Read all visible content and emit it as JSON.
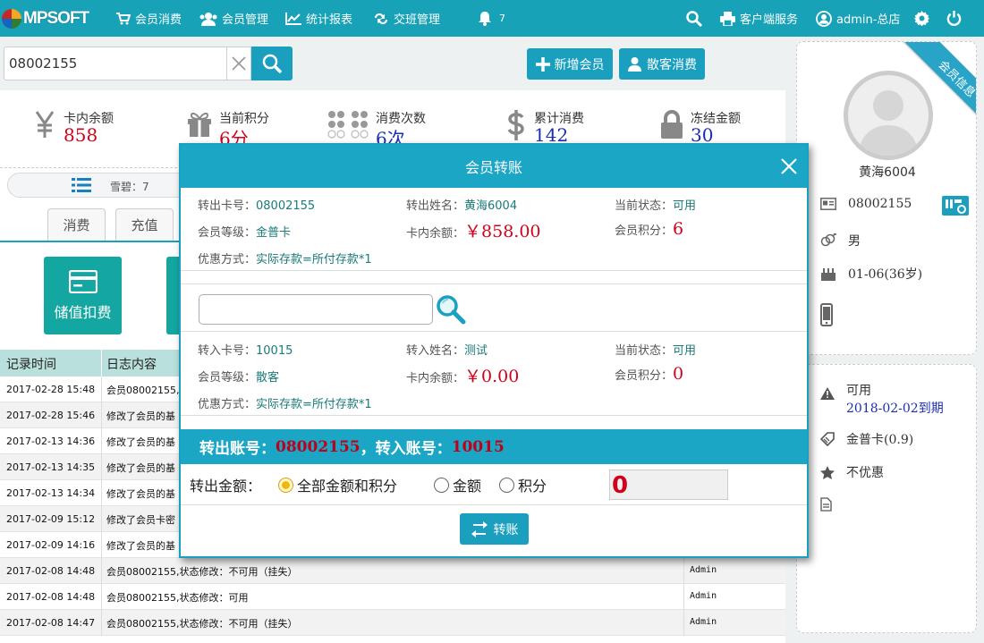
{
  "brand": {
    "logo_text": "MPSOFT"
  },
  "nav": {
    "items": [
      {
        "label": "会员消费",
        "icon": "cart-icon"
      },
      {
        "label": "会员管理",
        "icon": "users-icon"
      },
      {
        "label": "统计报表",
        "icon": "chart-icon"
      },
      {
        "label": "交班管理",
        "icon": "swap-icon"
      },
      {
        "label": "7",
        "icon": "bell-icon"
      }
    ],
    "client_service": "客户端服务",
    "user": "admin-总店"
  },
  "search": {
    "value": "08002155",
    "placeholder": ""
  },
  "actions": {
    "add_member": "新增会员",
    "walk_in": "散客消费"
  },
  "stats": [
    {
      "label": "卡内余额",
      "value": "858",
      "icon": "yen-icon"
    },
    {
      "label": "当前积分",
      "value": "6分",
      "icon": "gift-icon"
    },
    {
      "label": "消费次数",
      "value": "6次",
      "icon": "dots-grid-icon"
    },
    {
      "label": "累计消费",
      "value": "142",
      "icon": "dollar-icon"
    },
    {
      "label": "冻结金额",
      "value": "30",
      "icon": "lock-icon"
    }
  ],
  "pillbar": {
    "text": "雪碧：7"
  },
  "tabs": [
    "消费",
    "充值"
  ],
  "tiles": [
    {
      "label": "储值扣费"
    }
  ],
  "log": {
    "headers": [
      "记录时间",
      "日志内容"
    ],
    "rows": [
      {
        "time": "2017-02-28 15:48",
        "desc": "会员08002155,",
        "user": ""
      },
      {
        "time": "2017-02-28 15:46",
        "desc": "修改了会员的基",
        "user": ""
      },
      {
        "time": "2017-02-13 14:36",
        "desc": "修改了会员的基",
        "user": ""
      },
      {
        "time": "2017-02-13 14:35",
        "desc": "修改了会员的基",
        "user": ""
      },
      {
        "time": "2017-02-13 14:34",
        "desc": "修改了会员的基",
        "user": ""
      },
      {
        "time": "2017-02-09 15:12",
        "desc": "修改了会员卡密",
        "user": ""
      },
      {
        "time": "2017-02-09 14:16",
        "desc": "修改了会员的基",
        "user": ""
      },
      {
        "time": "2017-02-08 14:48",
        "desc": "会员08002155,状态修改：不可用（挂失）",
        "user": "Admin"
      },
      {
        "time": "2017-02-08 14:48",
        "desc": "会员08002155,状态修改：可用",
        "user": "Admin"
      },
      {
        "time": "2017-02-08 14:47",
        "desc": "会员08002155,状态修改：不可用（挂失）",
        "user": "Admin"
      }
    ]
  },
  "member": {
    "ribbon": "会员信息",
    "name": "黄海6004",
    "card": "08002155",
    "gender": "男",
    "birthday": "01-06(36岁)",
    "phone": "",
    "status": "可用",
    "expiry": "2018-02-02到期",
    "level": "金普卡(0.9)",
    "discount": "不优惠",
    "note": ""
  },
  "modal": {
    "title": "会员转账",
    "from": {
      "card_label": "转出卡号：",
      "card": "08002155",
      "name_label": "转出姓名：",
      "name": "黄海6004",
      "status_label": "当前状态：",
      "status": "可用",
      "level_label": "会员等级：",
      "level": "金普卡",
      "balance_label": "卡内余额：",
      "balance": "￥858.00",
      "points_label": "会员积分：",
      "points": "6",
      "discount_label": "优惠方式：",
      "discount": "实际存款=所付存款*1"
    },
    "search": {
      "value": "",
      "placeholder": ""
    },
    "to": {
      "card_label": "转入卡号：",
      "card": "10015",
      "name_label": "转入姓名：",
      "name": "测试",
      "status_label": "当前状态：",
      "status": "可用",
      "level_label": "会员等级：",
      "level": "散客",
      "balance_label": "卡内余额：",
      "balance": "￥0.00",
      "points_label": "会员积分：",
      "points": "0",
      "discount_label": "优惠方式：",
      "discount": "实际存款=所付存款*1"
    },
    "summary": {
      "from_label": "转出账号：",
      "from_value": "08002155",
      "sep": "，",
      "to_label": "转入账号：",
      "to_value": "10015"
    },
    "amount_label": "转出金额：",
    "options": [
      "全部金额和积分",
      "金额",
      "积分"
    ],
    "selected_option": "全部金额和积分",
    "amount_value": "0",
    "submit": "转账"
  },
  "colors": {
    "primary": "#18a2b8",
    "accent_red": "#d0021b",
    "tile": "#14a6a0"
  }
}
